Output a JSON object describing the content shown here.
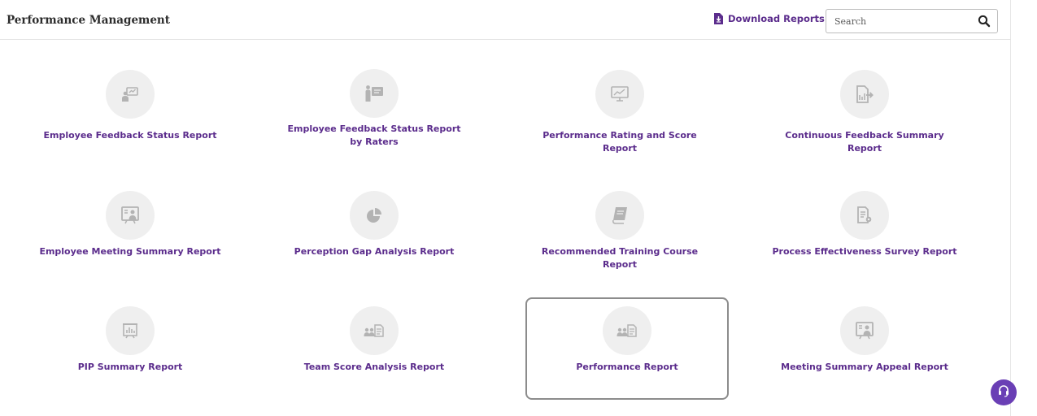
{
  "header": {
    "title": "Performance Management",
    "download_label": "Download Reports",
    "search_placeholder": "Search"
  },
  "colors": {
    "accent": "#5b2c8c",
    "icon_circle": "#efefef",
    "icon_glyph": "#b3b3b3",
    "help_button": "#6a3fb5"
  },
  "reports": [
    {
      "label": "Employee Feedback Status Report",
      "icon": "presentation-chart-icon"
    },
    {
      "label": "Employee Feedback Status Report by Raters",
      "icon": "presenter-board-icon"
    },
    {
      "label": "Performance Rating and Score Report",
      "icon": "monitor-chart-icon"
    },
    {
      "label": "Continuous Feedback Summary Report",
      "icon": "document-export-icon"
    },
    {
      "label": "Employee Meeting Summary Report",
      "icon": "meeting-board-icon"
    },
    {
      "label": "Perception Gap Analysis Report",
      "icon": "pie-chart-icon"
    },
    {
      "label": "Recommended Training Course Report",
      "icon": "book-icon"
    },
    {
      "label": "Process Effectiveness Survey Report",
      "icon": "document-settings-icon"
    },
    {
      "label": "PIP Summary Report",
      "icon": "bar-chart-board-icon"
    },
    {
      "label": "Team Score Analysis Report",
      "icon": "team-document-icon"
    },
    {
      "label": "Performance Report",
      "icon": "team-document-icon"
    },
    {
      "label": "Meeting Summary Appeal Report",
      "icon": "meeting-board-icon"
    }
  ],
  "selected_report": "Performance Report"
}
